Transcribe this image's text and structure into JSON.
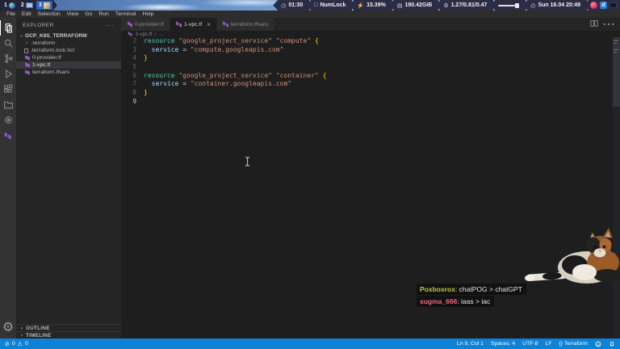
{
  "taskbar": {
    "workspaces": [
      {
        "number": "1",
        "icon": "globe",
        "active": false
      },
      {
        "number": "2",
        "icon": "monitor",
        "active": false
      },
      {
        "number": "3",
        "icon": "editor",
        "active": true
      }
    ],
    "stats": {
      "timer": "01:30",
      "numlock": "NumLock",
      "cpu": "15.39%",
      "memory": "190.42GiB",
      "load": "1.27/0.81/0.47",
      "date": "Sun 16.04 20:49"
    },
    "tray_d_label": "d"
  },
  "menubar": {
    "items": [
      "File",
      "Edit",
      "Selection",
      "View",
      "Go",
      "Run",
      "Terminal",
      "Help"
    ]
  },
  "explorer": {
    "title": "EXPLORER",
    "more": "···",
    "root": "GCP_K8S_TERRAFORM",
    "files": [
      {
        "label": ".terraform",
        "icon": "chevron",
        "selected": false
      },
      {
        "label": ".terraform.lock.hcl",
        "icon": "file",
        "selected": false
      },
      {
        "label": "0-provider.tf",
        "icon": "terraform",
        "selected": false
      },
      {
        "label": "1-vpc.tf",
        "icon": "terraform",
        "selected": true
      },
      {
        "label": "terraform.tfvars",
        "icon": "terraform",
        "selected": false
      }
    ],
    "sections": [
      {
        "label": "OUTLINE"
      },
      {
        "label": "TIMELINE"
      }
    ]
  },
  "tabs": [
    {
      "label": "0-provider.tf",
      "active": false
    },
    {
      "label": "1-vpc.tf",
      "active": true,
      "close": "×"
    },
    {
      "label": "terraform.tfvars",
      "active": false
    }
  ],
  "breadcrumb": {
    "file": "1-vpc.tf",
    "sep": "›",
    "more": "…"
  },
  "editor_actions": {
    "more": "⋯"
  },
  "code": {
    "language_id": "terraform",
    "lines": [
      {
        "num": "2",
        "current": false,
        "tokens": [
          [
            "kw",
            "resource"
          ],
          [
            "pl",
            " "
          ],
          [
            "str",
            "\"google_project_service\""
          ],
          [
            "pl",
            " "
          ],
          [
            "str",
            "\"compute\""
          ],
          [
            "pl",
            " "
          ],
          [
            "br",
            "{"
          ]
        ]
      },
      {
        "num": "3",
        "current": false,
        "tokens": [
          [
            "pl",
            "  "
          ],
          [
            "prop",
            "service"
          ],
          [
            "pl",
            " "
          ],
          [
            "op",
            "="
          ],
          [
            "pl",
            " "
          ],
          [
            "str",
            "\"compute.googleapis.com\""
          ]
        ]
      },
      {
        "num": "4",
        "current": false,
        "tokens": [
          [
            "br",
            "}"
          ]
        ]
      },
      {
        "num": "5",
        "current": false,
        "tokens": []
      },
      {
        "num": "6",
        "current": false,
        "tokens": [
          [
            "kw",
            "resource"
          ],
          [
            "pl",
            " "
          ],
          [
            "str",
            "\"google_project_service\""
          ],
          [
            "pl",
            " "
          ],
          [
            "str",
            "\"container\""
          ],
          [
            "pl",
            " "
          ],
          [
            "br",
            "{"
          ]
        ]
      },
      {
        "num": "7",
        "current": false,
        "tokens": [
          [
            "pl",
            "  "
          ],
          [
            "prop",
            "service"
          ],
          [
            "pl",
            " "
          ],
          [
            "op",
            "="
          ],
          [
            "pl",
            " "
          ],
          [
            "str",
            "\"container.googleapis.com\""
          ]
        ]
      },
      {
        "num": "8",
        "current": false,
        "tokens": [
          [
            "br",
            "}"
          ]
        ]
      },
      {
        "num": "9",
        "current": true,
        "tokens": []
      }
    ]
  },
  "statusbar": {
    "errors": "0",
    "warnings": "0",
    "cursor": "Ln 9, Col 1",
    "indent": "Spaces: 4",
    "encoding": "UTF-8",
    "eol": "LF",
    "language_glyph": "{}",
    "language": "Terraform"
  },
  "chat": {
    "messages": [
      {
        "user": "Poxboxrox",
        "sep": ": ",
        "text": "chatPOG > chatGPT"
      },
      {
        "user": "sugma_666",
        "sep": ": ",
        "text": "iaas > iac"
      }
    ]
  },
  "colors": {
    "statusbar_blue": "#0f82d6",
    "terraform_purple": "#8a5cc0",
    "chat_user1": "#bdcf3a",
    "chat_user2": "#f0687e",
    "keyword": "#4ec9b0",
    "string": "#ce9178",
    "property": "#9cdcfe",
    "brace": "#ffd700"
  }
}
